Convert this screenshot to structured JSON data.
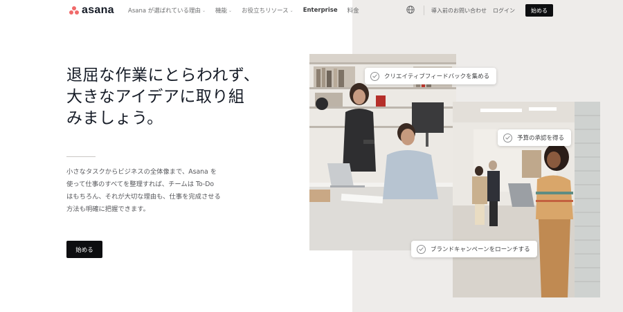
{
  "brand": {
    "name": "asana",
    "accent": "#f06a6a"
  },
  "nav": {
    "items": [
      {
        "label": "Asana が選ばれている理由",
        "dropdown": true
      },
      {
        "label": "機能",
        "dropdown": true
      },
      {
        "label": "お役立ちリソース",
        "dropdown": true
      },
      {
        "label": "Enterprise",
        "dropdown": false
      },
      {
        "label": "料金",
        "dropdown": false
      }
    ],
    "language_icon": "globe-icon",
    "contact_label": "導入前のお問い合わせ",
    "login_label": "ログイン",
    "cta_label": "始める"
  },
  "hero": {
    "title": "退屈な作業にとらわれず、大きなアイデアに取り組みましょう。",
    "description": "小さなタスクからビジネスの全体像まで、Asana を使って仕事のすべてを整理すれば、チームは To-Do はもちろん、それが大切な理由も、仕事を完成させる方法も明確に把握できます。",
    "cta_label": "始める"
  },
  "chips": {
    "chip1": "クリエイティブフィードバックを集める",
    "chip2": "予算の承認を得る",
    "chip3": "ブランドキャンペーンをローンチする"
  }
}
